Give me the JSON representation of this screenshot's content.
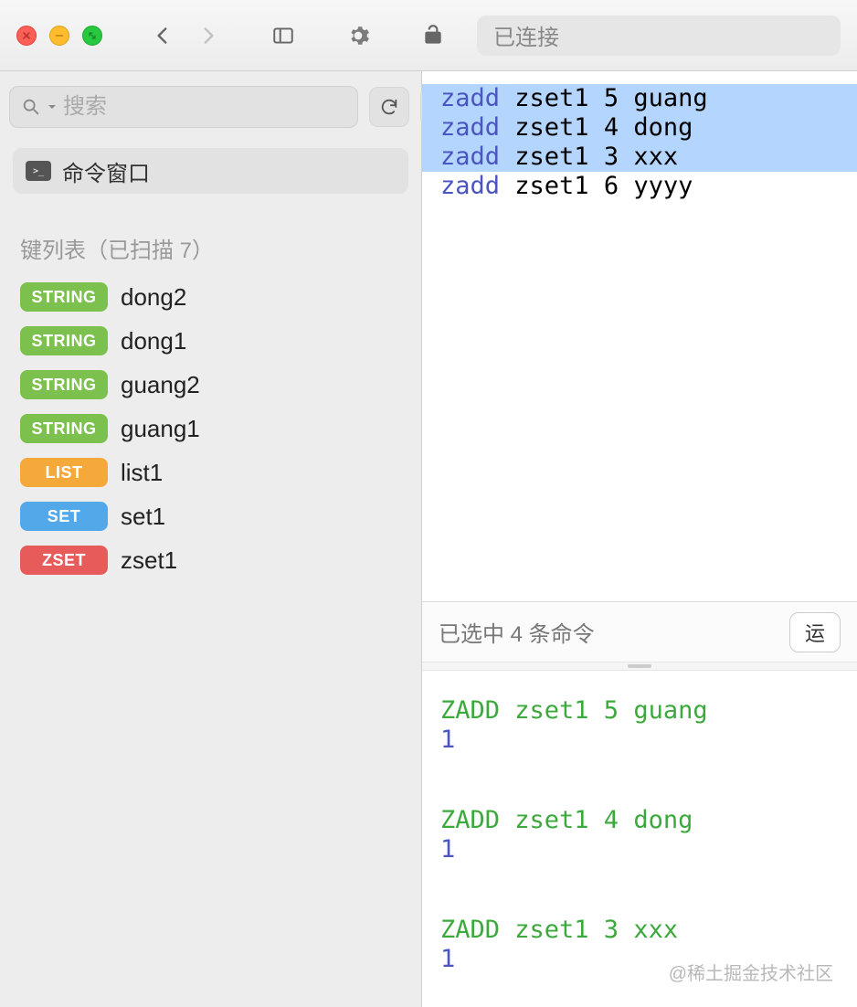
{
  "toolbar": {
    "connection_status": "已连接"
  },
  "sidebar": {
    "search_placeholder": "搜索",
    "command_window_label": "命令窗口",
    "section_label": "键列表（已扫描 7）",
    "keys": [
      {
        "type": "STRING",
        "type_class": "type-string",
        "name": "dong2"
      },
      {
        "type": "STRING",
        "type_class": "type-string",
        "name": "dong1"
      },
      {
        "type": "STRING",
        "type_class": "type-string",
        "name": "guang2"
      },
      {
        "type": "STRING",
        "type_class": "type-string",
        "name": "guang1"
      },
      {
        "type": "LIST",
        "type_class": "type-list",
        "name": "list1"
      },
      {
        "type": "SET",
        "type_class": "type-set",
        "name": "set1"
      },
      {
        "type": "ZSET",
        "type_class": "type-zset",
        "name": "zset1"
      }
    ]
  },
  "editor": {
    "lines": [
      {
        "keyword": "zadd",
        "rest": " zset1 5 guang",
        "selected": true
      },
      {
        "keyword": "zadd",
        "rest": " zset1 4 dong",
        "selected": true
      },
      {
        "keyword": "zadd",
        "rest": " zset1 3 xxx",
        "selected": true
      },
      {
        "keyword": "zadd",
        "rest": " zset1 6 yyyy",
        "selected": false
      }
    ]
  },
  "status": {
    "selected_text": "已选中 4 条命令",
    "run_label": "运"
  },
  "output": {
    "blocks": [
      {
        "cmd": "ZADD zset1 5 guang",
        "result": "1"
      },
      {
        "cmd": "ZADD zset1 4 dong",
        "result": "1"
      },
      {
        "cmd": "ZADD zset1 3 xxx",
        "result": "1"
      }
    ]
  },
  "watermark": "@稀土掘金技术社区"
}
